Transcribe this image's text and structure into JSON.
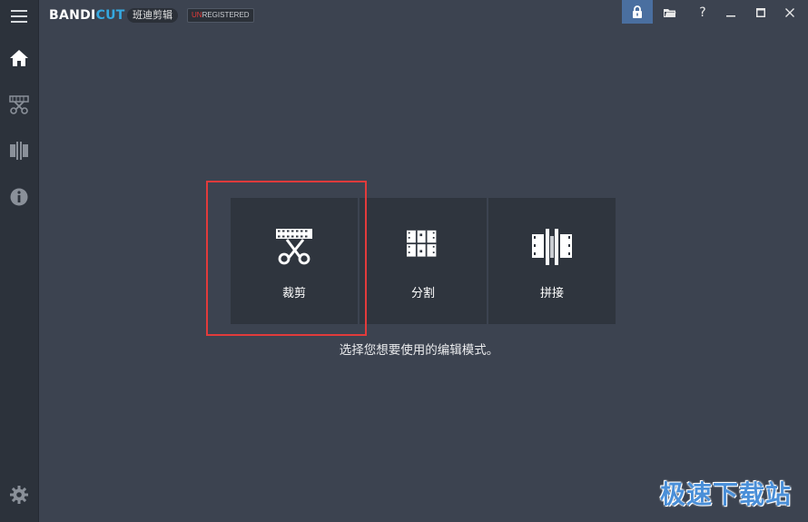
{
  "app": {
    "brand_part1": "BANDI",
    "brand_part2": "CUT",
    "cn_name": "班迪剪辑",
    "unreg_part1": "UN",
    "unreg_part2": "REGISTERED"
  },
  "titlebar": {
    "help_label": "?",
    "icons": [
      "lock-icon",
      "folder-icon",
      "help-icon",
      "minimize-icon",
      "maximize-icon",
      "close-icon"
    ]
  },
  "sidebar": {
    "icons": [
      "menu-icon",
      "home-icon",
      "cut-icon",
      "join-icon",
      "info-icon",
      "gear-icon"
    ]
  },
  "modes": [
    {
      "label": "裁剪",
      "icon": "scissors-film-icon"
    },
    {
      "label": "分割",
      "icon": "grid-split-icon"
    },
    {
      "label": "拼接",
      "icon": "film-join-icon"
    }
  ],
  "prompt": "选择您想要使用的编辑模式。",
  "watermark": "极速下载站",
  "colors": {
    "accent": "#35a8e0",
    "highlight": "#e23b3b",
    "background": "#3c4350",
    "sidebar": "#2c323b",
    "tile": "#2f353e"
  }
}
